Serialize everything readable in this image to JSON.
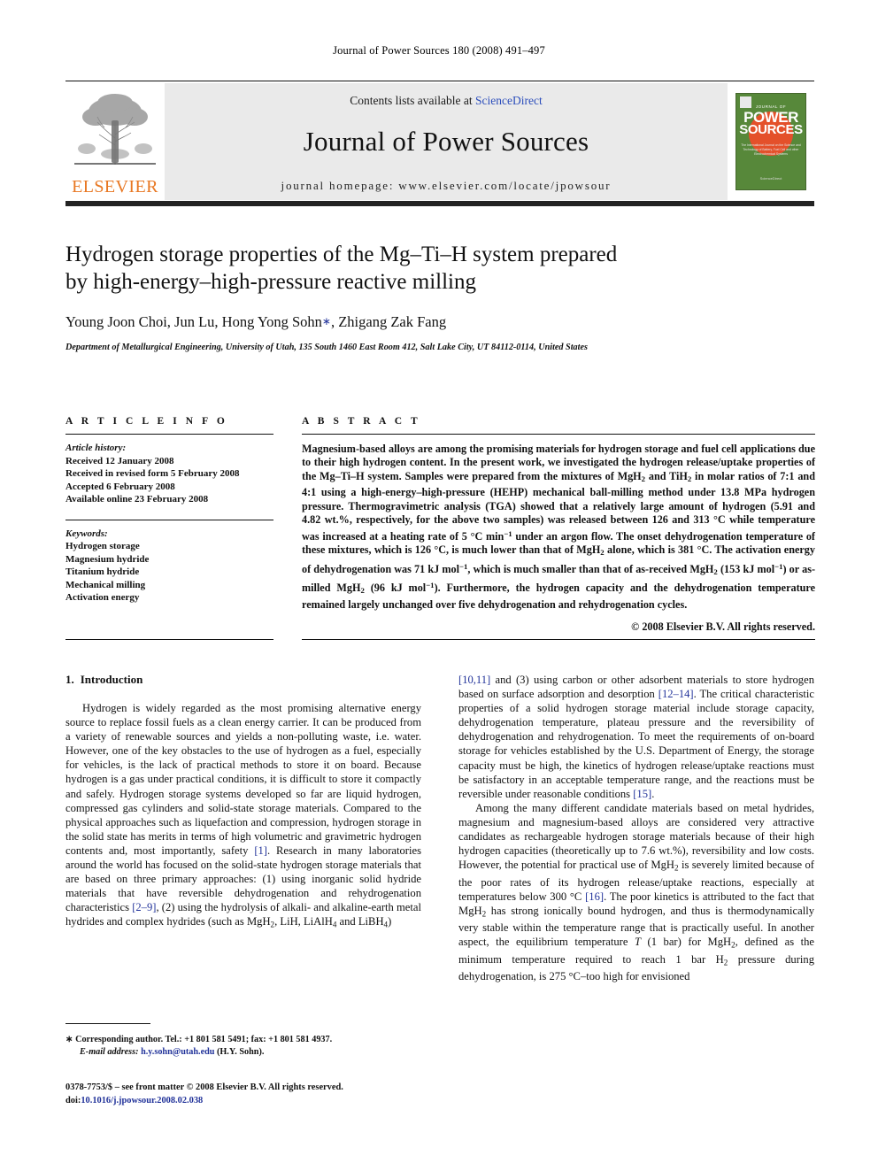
{
  "running_head": "Journal of Power Sources 180 (2008) 491–497",
  "masthead": {
    "contents_prefix": "Contents lists available at ",
    "sciencedirect": "ScienceDirect",
    "journal_title": "Journal of Power Sources",
    "homepage": "journal homepage: www.elsevier.com/locate/jpowsour",
    "publisher_wordmark": "ELSEVIER",
    "cover": {
      "journal_of": "JOURNAL OF",
      "power": "POWER",
      "sources": "SOURCES",
      "subtitle": "The International Journal on the Science and Technology of Battery, Fuel Cell and other Electrochemical Systems",
      "sciencedirect_badge": "ScienceDirect"
    },
    "colors": {
      "link_blue": "#2b4dbb",
      "elsevier_orange": "#e87722",
      "cover_green": "#57883a",
      "cover_orange": "#e4502a",
      "band_grey": "#eaeaea"
    }
  },
  "title": "Hydrogen storage properties of the Mg–Ti–H system prepared by high-energy–high-pressure reactive milling",
  "authors": "Young Joon Choi, Jun Lu, Hong Yong Sohn",
  "authors_suffix": ", Zhigang Zak Fang",
  "corresponding_marker": "∗",
  "affiliation": "Department of Metallurgical Engineering, University of Utah, 135 South 1460 East Room 412, Salt Lake City, UT 84112-0114, United States",
  "article_info": {
    "heading": "A R T I C L E  I N F O",
    "history_label": "Article history:",
    "history": [
      "Received 12 January 2008",
      "Received in revised form 5 February 2008",
      "Accepted 6 February 2008",
      "Available online 23 February 2008"
    ],
    "keywords_label": "Keywords:",
    "keywords": [
      "Hydrogen storage",
      "Magnesium hydride",
      "Titanium hydride",
      "Mechanical milling",
      "Activation energy"
    ]
  },
  "abstract": {
    "heading": "A B S T R A C T",
    "copyright": "© 2008 Elsevier B.V. All rights reserved."
  },
  "introduction": {
    "heading_number": "1.",
    "heading_text": "Introduction"
  },
  "footnote": {
    "line1": "∗ Corresponding author. Tel.: +1 801 581 5491; fax: +1 801 581 4937.",
    "email_label": "E-mail address:",
    "email": "h.y.sohn@utah.edu",
    "email_suffix": " (H.Y. Sohn)."
  },
  "bottom_matter": {
    "issn_line": "0378-7753/$ – see front matter © 2008 Elsevier B.V. All rights reserved.",
    "doi_label": "doi:",
    "doi": "10.1016/j.jpowsour.2008.02.038"
  }
}
